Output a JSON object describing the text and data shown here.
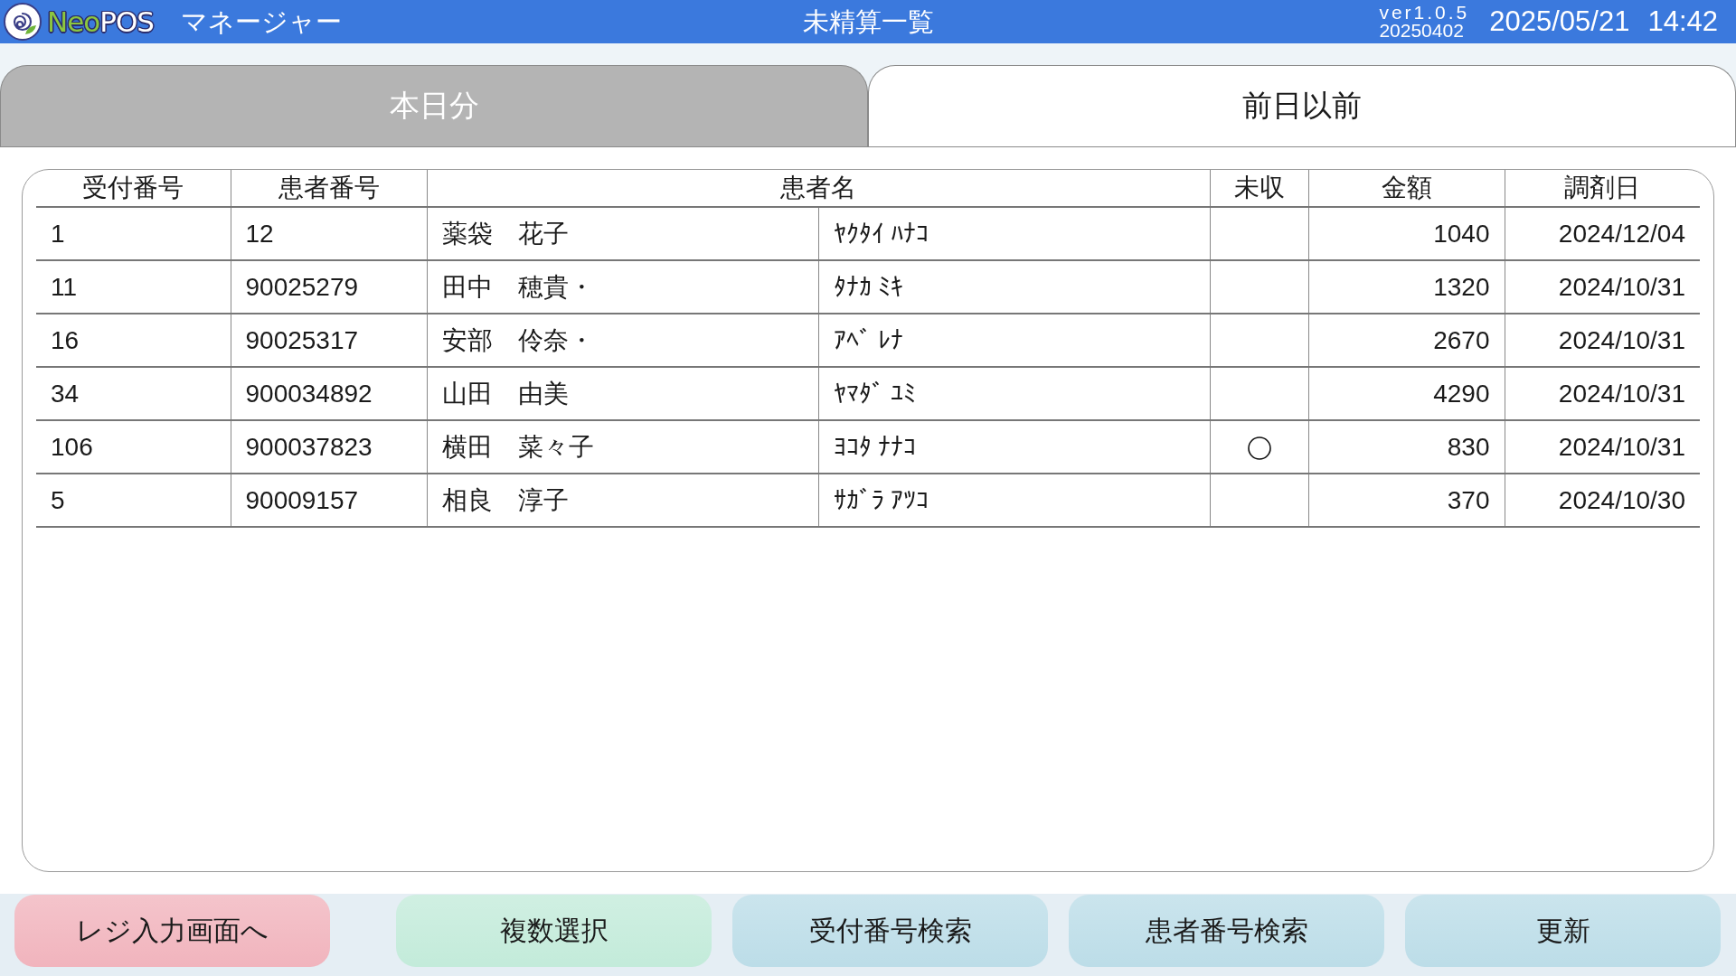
{
  "header": {
    "logo": {
      "part_1": "Neo",
      "part_2": "POS"
    },
    "app_name": "マネージャー",
    "title": "未精算一覧",
    "version": "ver1.0.5",
    "build": "20250402",
    "date": "2025/05/21",
    "time": "14:42"
  },
  "tabs": [
    {
      "label": "本日分",
      "selected": false
    },
    {
      "label": "前日以前",
      "selected": true
    }
  ],
  "table": {
    "columns": [
      {
        "label": "受付番号",
        "kind": "single"
      },
      {
        "label": "患者番号",
        "kind": "single"
      },
      {
        "label": "患者名",
        "kind": "split"
      },
      {
        "label": "未収",
        "kind": "single"
      },
      {
        "label": "金額",
        "kind": "single"
      },
      {
        "label": "調剤日",
        "kind": "single"
      }
    ],
    "rows": [
      {
        "reception_no": "1",
        "patient_no": "12",
        "name": "薬袋　花子",
        "name_kana": "ﾔｸﾀｲ ﾊﾅｺ",
        "unpaid": false,
        "amount": "1040",
        "dispensed_on": "2024/12/04"
      },
      {
        "reception_no": "11",
        "patient_no": "90025279",
        "name": "田中　穂貴・",
        "name_kana": "ﾀﾅｶ ﾐｷ",
        "unpaid": false,
        "amount": "1320",
        "dispensed_on": "2024/10/31"
      },
      {
        "reception_no": "16",
        "patient_no": "90025317",
        "name": "安部　伶奈・",
        "name_kana": "ｱﾍﾞ ﾚﾅ",
        "unpaid": false,
        "amount": "2670",
        "dispensed_on": "2024/10/31"
      },
      {
        "reception_no": "34",
        "patient_no": "900034892",
        "name": "山田　由美",
        "name_kana": "ﾔﾏﾀﾞ ﾕﾐ",
        "unpaid": false,
        "amount": "4290",
        "dispensed_on": "2024/10/31"
      },
      {
        "reception_no": "106",
        "patient_no": "900037823",
        "name": "横田　菜々子",
        "name_kana": "ﾖｺﾀ ﾅﾅｺ",
        "unpaid": true,
        "amount": "830",
        "dispensed_on": "2024/10/31"
      },
      {
        "reception_no": "5",
        "patient_no": "90009157",
        "name": "相良　淳子",
        "name_kana": "ｻｶﾞﾗ ｱﾂｺ",
        "unpaid": false,
        "amount": "370",
        "dispensed_on": "2024/10/30"
      }
    ]
  },
  "buttons": [
    {
      "label": "レジ入力画面へ",
      "color": "#f1b4bd"
    },
    {
      "label": "複数選択",
      "color": "#c3ebda"
    },
    {
      "label": "受付番号検索",
      "color": "#bcdde8"
    },
    {
      "label": "患者番号検索",
      "color": "#bcdde8"
    },
    {
      "label": "更新",
      "color": "#bcdde8"
    }
  ]
}
